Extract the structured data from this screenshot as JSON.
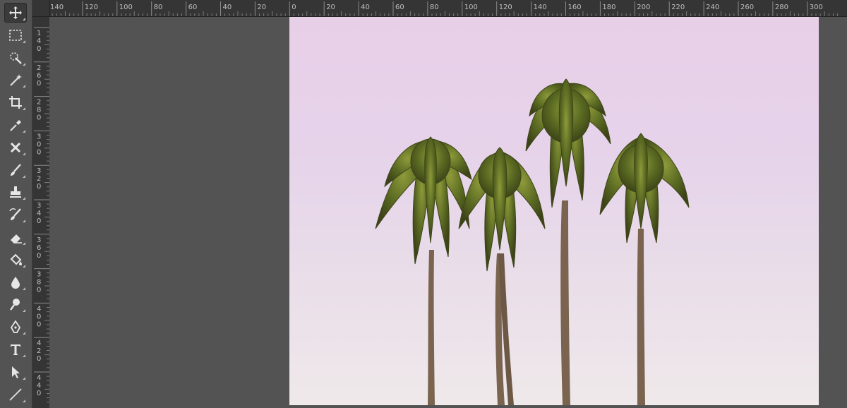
{
  "tools": [
    {
      "name": "move-tool",
      "icon": "move-icon",
      "active": true
    },
    {
      "name": "marquee-tool",
      "icon": "rect-marquee-icon",
      "active": false
    },
    {
      "name": "quick-selection-tool",
      "icon": "quick-selection-icon",
      "active": false
    },
    {
      "name": "magic-wand-tool",
      "icon": "magic-wand-icon",
      "active": false
    },
    {
      "name": "crop-tool",
      "icon": "crop-icon",
      "active": false
    },
    {
      "name": "eyedropper-tool",
      "icon": "eyedropper-icon",
      "active": false
    },
    {
      "name": "healing-brush-tool",
      "icon": "healing-brush-icon",
      "active": false
    },
    {
      "name": "brush-tool",
      "icon": "brush-icon",
      "active": false
    },
    {
      "name": "clone-stamp-tool",
      "icon": "stamp-icon",
      "active": false
    },
    {
      "name": "history-brush-tool",
      "icon": "history-brush-icon",
      "active": false
    },
    {
      "name": "eraser-tool",
      "icon": "eraser-icon",
      "active": false
    },
    {
      "name": "paint-bucket-tool",
      "icon": "paint-bucket-icon",
      "active": false
    },
    {
      "name": "blur-tool",
      "icon": "blur-drop-icon",
      "active": false
    },
    {
      "name": "dodge-tool",
      "icon": "dodge-icon",
      "active": false
    },
    {
      "name": "pen-tool",
      "icon": "pen-icon",
      "active": false
    },
    {
      "name": "type-tool",
      "icon": "type-icon",
      "active": false
    },
    {
      "name": "path-selection-tool",
      "icon": "arrow-icon",
      "active": false
    },
    {
      "name": "line-tool",
      "icon": "line-icon",
      "active": false
    }
  ],
  "ruler": {
    "horizontal_labels": [
      "140",
      "120",
      "100",
      "80",
      "60",
      "40",
      "20",
      "0",
      "20",
      "40",
      "60",
      "80",
      "100",
      "120",
      "140",
      "160",
      "180",
      "200",
      "220",
      "240",
      "260",
      "280",
      "300"
    ],
    "vertical_labels": [
      "1 4 0",
      "2 6 0",
      "2 8 0",
      "3 0 0",
      "3 2 0",
      "3 4 0",
      "3 6 0",
      "3 8 0",
      "4 0 0",
      "4 2 0",
      "4 4 0"
    ]
  },
  "colors": {
    "pasteboard": "#535353",
    "ruler_bg": "#353535",
    "ruler_text": "#bfbfbf",
    "sky_top": "#e8cfe8",
    "sky_bottom": "#efe9ea",
    "palm_leaf": "#5a6a22",
    "palm_trunk": "#7a6450"
  }
}
